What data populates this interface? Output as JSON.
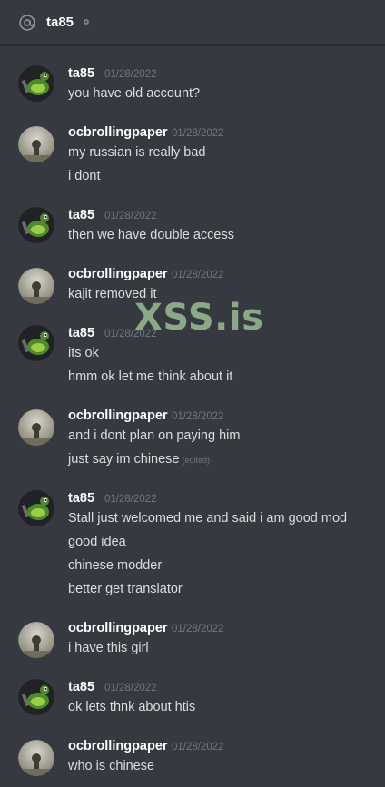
{
  "header": {
    "channel": "ta85",
    "icon": "at-icon",
    "status": "offline"
  },
  "watermark": "XSS.is",
  "messages": [
    {
      "author": "ta85",
      "avatar": "frog-avatar",
      "timestamp": "01/28/2022",
      "lines": [
        "you have old account?"
      ]
    },
    {
      "author": "ocbrollingpaper",
      "avatar": "photo-avatar",
      "timestamp": "01/28/2022",
      "lines": [
        "my russian is really bad",
        "i dont"
      ]
    },
    {
      "author": "ta85",
      "avatar": "frog-avatar",
      "timestamp": "01/28/2022",
      "lines": [
        "then we have double access"
      ]
    },
    {
      "author": "ocbrollingpaper",
      "avatar": "photo-avatar",
      "timestamp": "01/28/2022",
      "lines": [
        "kajit removed it"
      ]
    },
    {
      "author": "ta85",
      "avatar": "frog-avatar",
      "timestamp": "01/28/2022",
      "lines": [
        "its ok",
        "hmm ok let me think about it"
      ]
    },
    {
      "author": "ocbrollingpaper",
      "avatar": "photo-avatar",
      "timestamp": "01/28/2022",
      "lines": [
        "and i dont plan on paying him",
        "just say im chinese"
      ],
      "edited_label": "(edited)"
    },
    {
      "author": "ta85",
      "avatar": "frog-avatar",
      "timestamp": "01/28/2022",
      "lines": [
        "Stall just welcomed me and said i am good mod",
        "good idea",
        "chinese modder",
        "better get translator"
      ]
    },
    {
      "author": "ocbrollingpaper",
      "avatar": "photo-avatar",
      "timestamp": "01/28/2022",
      "lines": [
        "i have this girl"
      ]
    },
    {
      "author": "ta85",
      "avatar": "frog-avatar",
      "timestamp": "01/28/2022",
      "lines": [
        "ok lets thnk about htis"
      ]
    },
    {
      "author": "ocbrollingpaper",
      "avatar": "photo-avatar",
      "timestamp": "01/28/2022",
      "lines": [
        "who is chinese"
      ]
    }
  ],
  "colors": {
    "background": "#36393f",
    "author": "#ffffff",
    "text": "#dcddde",
    "timestamp": "#72767d",
    "watermark": "#9fc79a"
  }
}
